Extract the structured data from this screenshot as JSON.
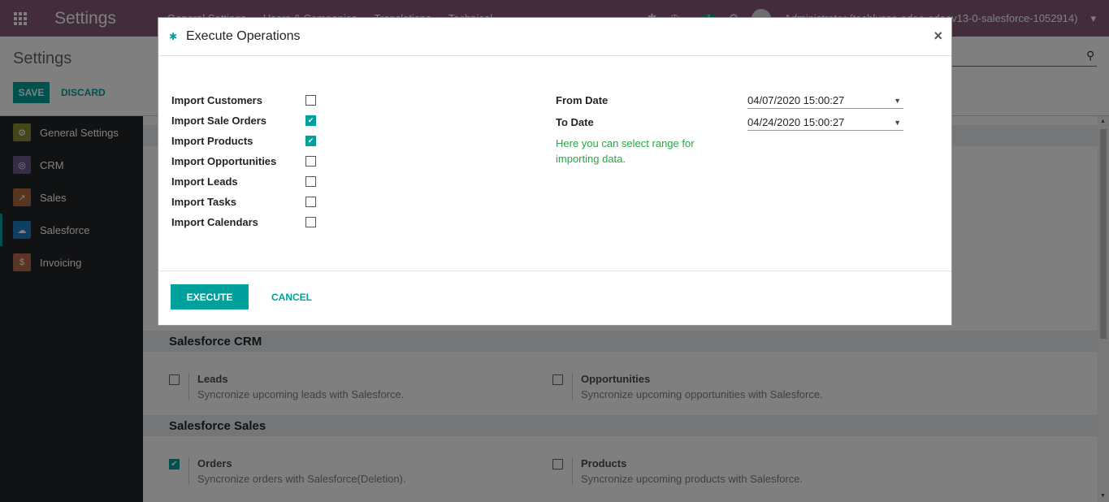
{
  "navbar": {
    "brand": "Settings",
    "menu": [
      "General Settings",
      "Users & Companies",
      "Translations",
      "Technical"
    ],
    "chat_count": "1",
    "user": "Administrator (techlusse-odoo-odoov13-0-salesforce-1052914)"
  },
  "control_panel": {
    "title": "Settings",
    "save": "SAVE",
    "discard": "DISCARD"
  },
  "sidebar": {
    "items": [
      {
        "label": "General Settings",
        "icon_color": "#8d8d3a"
      },
      {
        "label": "CRM",
        "icon_color": "#6d5b8a"
      },
      {
        "label": "Sales",
        "icon_color": "#b06b3c"
      },
      {
        "label": "Salesforce",
        "icon_color": "#1f7fbf"
      },
      {
        "label": "Invoicing",
        "icon_color": "#b56a46"
      }
    ]
  },
  "content": {
    "sections": [
      {
        "title": "Salesforce CRM",
        "settings": [
          {
            "title": "Leads",
            "desc": "Syncronize upcoming leads with Salesforce.",
            "checked": false
          },
          {
            "title": "Opportunities",
            "desc": "Syncronize upcoming opportunities with Salesforce.",
            "checked": false
          }
        ]
      },
      {
        "title": "Salesforce Sales",
        "settings": [
          {
            "title": "Orders",
            "desc": "Syncronize orders with Salesforce(Deletion).",
            "checked": true
          },
          {
            "title": "Products",
            "desc": "Syncronize upcoming products with Salesforce.",
            "checked": false
          }
        ]
      }
    ]
  },
  "modal": {
    "title": "Execute Operations",
    "close": "×",
    "imports": [
      {
        "label": "Import Customers",
        "checked": false
      },
      {
        "label": "Import Sale Orders",
        "checked": true
      },
      {
        "label": "Import Products",
        "checked": true
      },
      {
        "label": "Import Opportunities",
        "checked": false
      },
      {
        "label": "Import Leads",
        "checked": false
      },
      {
        "label": "Import Tasks",
        "checked": false
      },
      {
        "label": "Import Calendars",
        "checked": false
      }
    ],
    "from_date_label": "From Date",
    "from_date_value": "04/07/2020 15:00:27",
    "to_date_label": "To Date",
    "to_date_value": "04/24/2020 15:00:27",
    "hint": "Here you can select range for importing data.",
    "execute": "EXECUTE",
    "cancel": "CANCEL"
  },
  "colors": {
    "navbar": "#875a7b",
    "primary": "#00a09d",
    "hint": "#28a745"
  }
}
